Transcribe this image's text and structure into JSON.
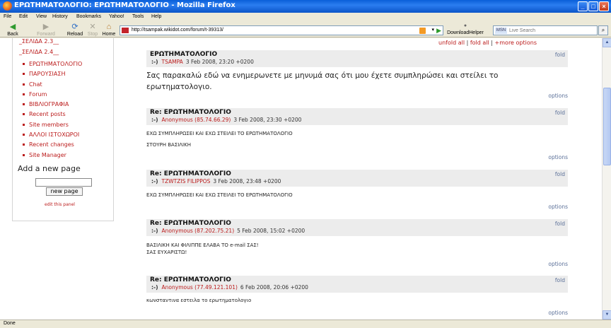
{
  "window": {
    "title": "ΕΡΩΤΗΜΑΤΟΛΟΓΙΟ: ΕΡΩΤΗΜΑΤΟΛΟΓΙΟ - Mozilla Firefox"
  },
  "menu": [
    "File",
    "Edit",
    "View",
    "History",
    "Bookmarks",
    "Yahoo!",
    "Tools",
    "Help"
  ],
  "toolbar": {
    "back": "Back",
    "forward": "Forward",
    "reload": "Reload",
    "stop": "Stop",
    "home": "Home",
    "url": "http://tsampak.wikidot.com/forum/t-39313/",
    "downloadhelper": "DownloadHelper",
    "search_placeholder": "Live Search",
    "search_engine": "MSN"
  },
  "sidebar": {
    "old_links": [
      "_ΣΕΛΙΔΑ 2.3__",
      "_ΣΕΛΙΔΑ 2.4__"
    ],
    "items": [
      "ΕΡΩΤΗΜΑΤΟΛΟΓΙΟ",
      "ΠΑΡΟΥΣΙΑΣΗ",
      "Chat",
      "Forum",
      "ΒΙΒΛΙΟΓΡΑΦΙΑ",
      "Recent posts",
      "Site members",
      "ΑΛΛΟΙ ΙΣΤΟΧΩΡΟΙ",
      "Recent changes",
      "Site Manager"
    ],
    "add_new_page": "Add a new page",
    "new_page_button": "new page",
    "edit_panel": "edit this panel"
  },
  "actions": {
    "unfold_all": "unfold all",
    "fold_all": "fold all",
    "more_options": "+more options"
  },
  "labels": {
    "fold": "fold",
    "options": "options"
  },
  "posts": [
    {
      "title": "ΕΡΩΤΗΜΑΤΟΛΟΓΙΟ",
      "face": ":-)",
      "author": "TSAMPA",
      "ip": "",
      "date": "3 Feb 2008, 23:20 +0200",
      "body": [
        "Σας παρακαλώ εδώ να ενημερωνετε με μηνυμά σας ότι μου έχετε συμπληρώσει και στείλει το ερωτηματολογιο."
      ]
    },
    {
      "title": "Re: ΕΡΩΤΗΜΑΤΟΛΟΓΙΟ",
      "face": ":-)",
      "author": "Anonymous",
      "ip": "(85.74.66.29)",
      "date": "3 Feb 2008, 23:30 +0200",
      "body": [
        "ΕΧΩ ΣΥΜΠΛΗΡΩΣΕΙ ΚΑΙ ΕΧΩ ΣΤΕΙΛΕΙ ΤΟ ΕΡΩΤΗΜΑΤΟΛΟΓΙΟ",
        "ΣΤΟΥΡΗ ΒΑΣΙΛΙΚΗ"
      ]
    },
    {
      "title": "Re: ΕΡΩΤΗΜΑΤΟΛΟΓΙΟ",
      "face": ":-)",
      "author": "TZWTZIS FILIPPOS",
      "ip": "",
      "date": "3 Feb 2008, 23:48 +0200",
      "body": [
        "ΕΧΩ ΣΥΜΠΛΗΡΩΣΕΙ ΚΑΙ ΕΧΩ ΣΤΕΙΛΕΙ ΤΟ ΕΡΩΤΗΜΑΤΟΛΟΓΙΟ"
      ]
    },
    {
      "title": "Re: ΕΡΩΤΗΜΑΤΟΛΟΓΙΟ",
      "face": ":-)",
      "author": "Anonymous",
      "ip": "(87.202.75.21)",
      "date": "5 Feb 2008, 15:02 +0200",
      "body": [
        "ΒΑΣΙΛΙΚΗ ΚΑΙ ΦΙΛΙΠΠΕ ΕΛΑΒΑ ΤΟ e-mail ΣΑΣ!",
        "ΣΑΣ ΕΥΧΑΡΙΣΤΩ!"
      ]
    },
    {
      "title": "Re: ΕΡΩΤΗΜΑΤΟΛΟΓΙΟ",
      "face": ":-)",
      "author": "Anonymous",
      "ip": "(77.49.121.101)",
      "date": "6 Feb 2008, 20:06 +0200",
      "body": [
        "κωνσταντινα εστειλα το ερωτηματολογιο"
      ]
    }
  ],
  "status": "Done",
  "colors": {
    "link": "#bb1b1b",
    "meta_link": "#5a6f98",
    "post_header_bg": "#ececec"
  }
}
